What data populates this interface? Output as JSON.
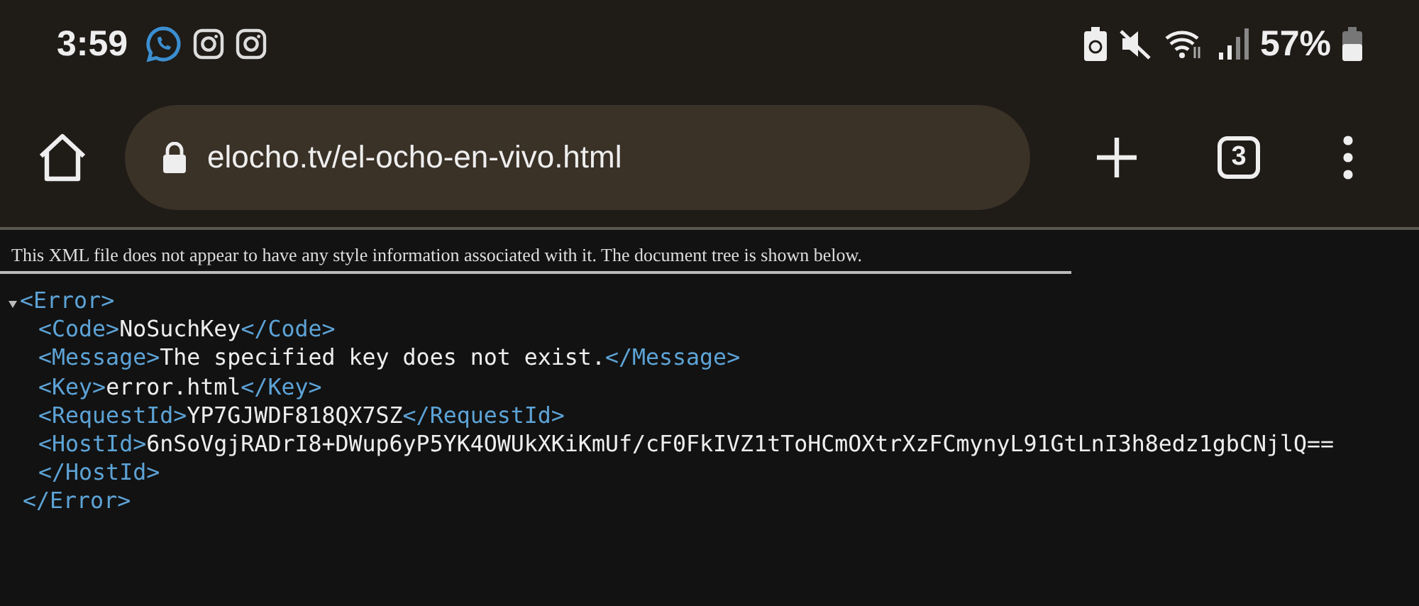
{
  "status_bar": {
    "time": "3:59",
    "battery": "57%"
  },
  "toolbar": {
    "url": "elocho.tv/el-ocho-en-vivo.html",
    "tab_count": "3"
  },
  "page": {
    "notice": "This XML file does not appear to have any style information associated with it. The document tree is shown below.",
    "root": {
      "open": "<Error>",
      "close": "</Error>",
      "expanded": true
    },
    "elements": [
      {
        "open": "<Code>",
        "value": "NoSuchKey",
        "close": "</Code>"
      },
      {
        "open": "<Message>",
        "value": "The specified key does not exist.",
        "close": "</Message>"
      },
      {
        "open": "<Key>",
        "value": "error.html",
        "close": "</Key>"
      },
      {
        "open": "<RequestId>",
        "value": "YP7GJWDF818QX7SZ",
        "close": "</RequestId>"
      },
      {
        "open": "<HostId>",
        "value": "6nSoVgjRADrI8+DWup6yP5YK4OWUkXKiKmUf/cF0FkIVZ1tToHCmOXtrXzFCmynyL91GtLnI3h8edz1gbCNjlQ==",
        "close": "</HostId>"
      }
    ]
  }
}
